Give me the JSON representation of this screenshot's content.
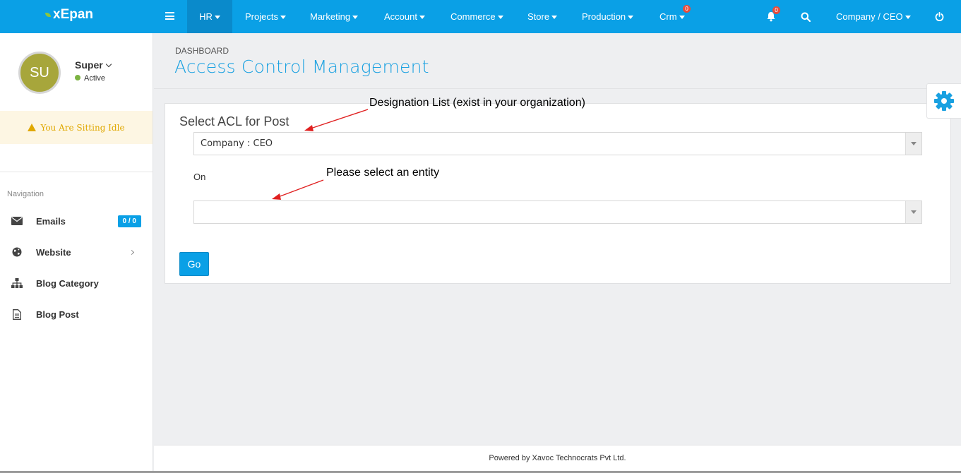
{
  "app": {
    "logo": "xEpan"
  },
  "topnav": {
    "items": [
      {
        "label": "HR",
        "active": true
      },
      {
        "label": "Projects"
      },
      {
        "label": "Marketing"
      },
      {
        "label": "Account"
      },
      {
        "label": "Commerce"
      },
      {
        "label": "Store"
      },
      {
        "label": "Production"
      },
      {
        "label": "Crm",
        "badge": "0"
      }
    ],
    "notifications_badge": "0",
    "user_menu": "Company / CEO"
  },
  "sidebar": {
    "avatar_initials": "SU",
    "user_name": "Super",
    "status": "Active",
    "idle_message": "You Are Sitting Idle",
    "nav_heading": "Navigation",
    "items": [
      {
        "label": "Emails",
        "icon": "envelope-icon",
        "badge": "0 / 0"
      },
      {
        "label": "Website",
        "icon": "globe-icon"
      },
      {
        "label": "Blog Category",
        "icon": "sitemap-icon"
      },
      {
        "label": "Blog Post",
        "icon": "document-icon"
      }
    ]
  },
  "page": {
    "breadcrumb": "DASHBOARD",
    "title": "Access Control Management"
  },
  "form": {
    "panel_title": "Select ACL for Post",
    "post_select_value": "Company : CEO",
    "on_label": "On",
    "entity_select_value": "",
    "go_label": "Go"
  },
  "annotations": {
    "designation": "Designation List (exist in your organization)",
    "entity": "Please select an entity"
  },
  "footer": {
    "text": "Powered by Xavoc Technocrats Pvt Ltd."
  },
  "colors": {
    "brand": "#0aa0e6",
    "title": "#1aa1e1",
    "idle": "#e0a800",
    "annotation_arrow": "#e02020"
  }
}
